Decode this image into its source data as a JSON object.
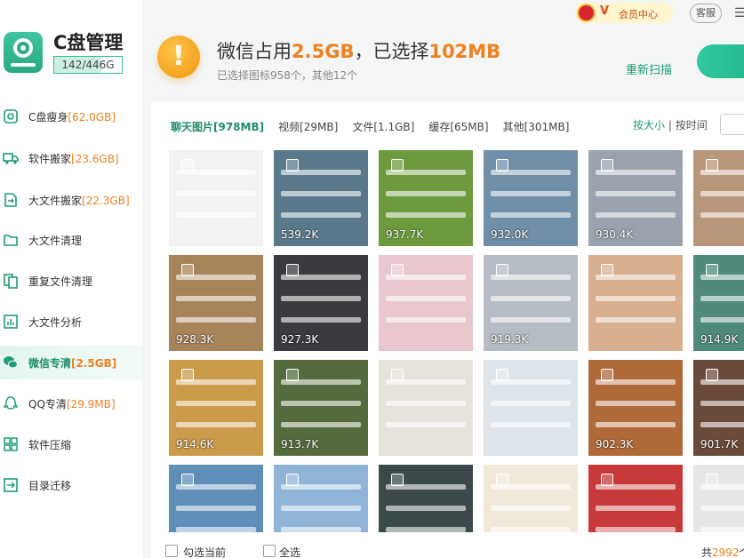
{
  "app": {
    "title": "C盘管理",
    "disk_usage": "142/446G",
    "disk_used_fraction": 0.32
  },
  "sidebar": {
    "items": [
      {
        "label": "C盘瘦身",
        "size": "[62.0GB]",
        "icon": "c-drive-slim-icon"
      },
      {
        "label": "软件搬家",
        "size": "[23.6GB]",
        "icon": "truck-icon"
      },
      {
        "label": "大文件搬家",
        "size": "[22.3GB]",
        "icon": "file-move-icon"
      },
      {
        "label": "大文件清理",
        "size": "",
        "icon": "folder-icon"
      },
      {
        "label": "重复文件清理",
        "size": "",
        "icon": "duplicate-icon"
      },
      {
        "label": "大文件分析",
        "size": "",
        "icon": "chart-icon"
      },
      {
        "label": "微信专清",
        "size": "[2.5GB]",
        "icon": "wechat-icon",
        "active": true
      },
      {
        "label": "QQ专清",
        "size": "[29.9MB]",
        "icon": "qq-icon"
      },
      {
        "label": "软件压缩",
        "size": "",
        "icon": "compress-icon"
      },
      {
        "label": "目录迁移",
        "size": "",
        "icon": "migrate-icon"
      }
    ]
  },
  "header": {
    "member_label": "会员中心",
    "member_v": "V",
    "support_label": "客服",
    "menu_glyph": "☰",
    "headline_prefix": "微信占用",
    "headline_used": "2.5GB",
    "headline_mid": "，已选择",
    "headline_selected": "102MB",
    "subline": "已选择图标958个，其他12个",
    "rescan_label": "重新扫描",
    "warn_glyph": "!"
  },
  "tabs": [
    {
      "label": "聊天图片[978MB]",
      "active": true
    },
    {
      "label": "视频[29MB]",
      "active": false
    },
    {
      "label": "文件[1.1GB]",
      "active": false
    },
    {
      "label": "缓存[65MB]",
      "active": false
    },
    {
      "label": "其他[301MB]",
      "active": false
    }
  ],
  "sort": {
    "by_size": "按大小",
    "separator": " | ",
    "by_time": "按时间"
  },
  "images": [
    {
      "size": "",
      "color": "#f2f2f2"
    },
    {
      "size": "539.2K",
      "color": "#5a7a8c"
    },
    {
      "size": "937.7K",
      "color": "#6e9a3e"
    },
    {
      "size": "932.0K",
      "color": "#6f8fa8"
    },
    {
      "size": "930.4K",
      "color": "#9aa3ad"
    },
    {
      "size": "",
      "color": "#b8967a"
    },
    {
      "size": "928.3K",
      "color": "#a8845a"
    },
    {
      "size": "927.3K",
      "color": "#3c3a3e"
    },
    {
      "size": "",
      "color": "#e8c8cc"
    },
    {
      "size": "919.3K",
      "color": "#b6bcc4"
    },
    {
      "size": "",
      "color": "#d8b090"
    },
    {
      "size": "914.9K",
      "color": "#4f8a7a"
    },
    {
      "size": "914.6K",
      "color": "#c99b4a"
    },
    {
      "size": "913.7K",
      "color": "#556b3e"
    },
    {
      "size": "",
      "color": "#e6e2dc"
    },
    {
      "size": "",
      "color": "#dde4ea"
    },
    {
      "size": "902.3K",
      "color": "#b06a3a"
    },
    {
      "size": "901.7K",
      "color": "#6a4a3a"
    },
    {
      "size": "",
      "color": "#5f8fb8"
    },
    {
      "size": "",
      "color": "#8fb4d8"
    },
    {
      "size": "",
      "color": "#3a4a4a"
    },
    {
      "size": "",
      "color": "#f0e8d8"
    },
    {
      "size": "",
      "color": "#c83a3a"
    },
    {
      "size": "",
      "color": "#e6e6e6"
    }
  ],
  "bottom": {
    "select_page": "勾选当前",
    "select_all": "全选",
    "total_prefix": "共",
    "total_count": "2992",
    "total_suffix": "个"
  }
}
